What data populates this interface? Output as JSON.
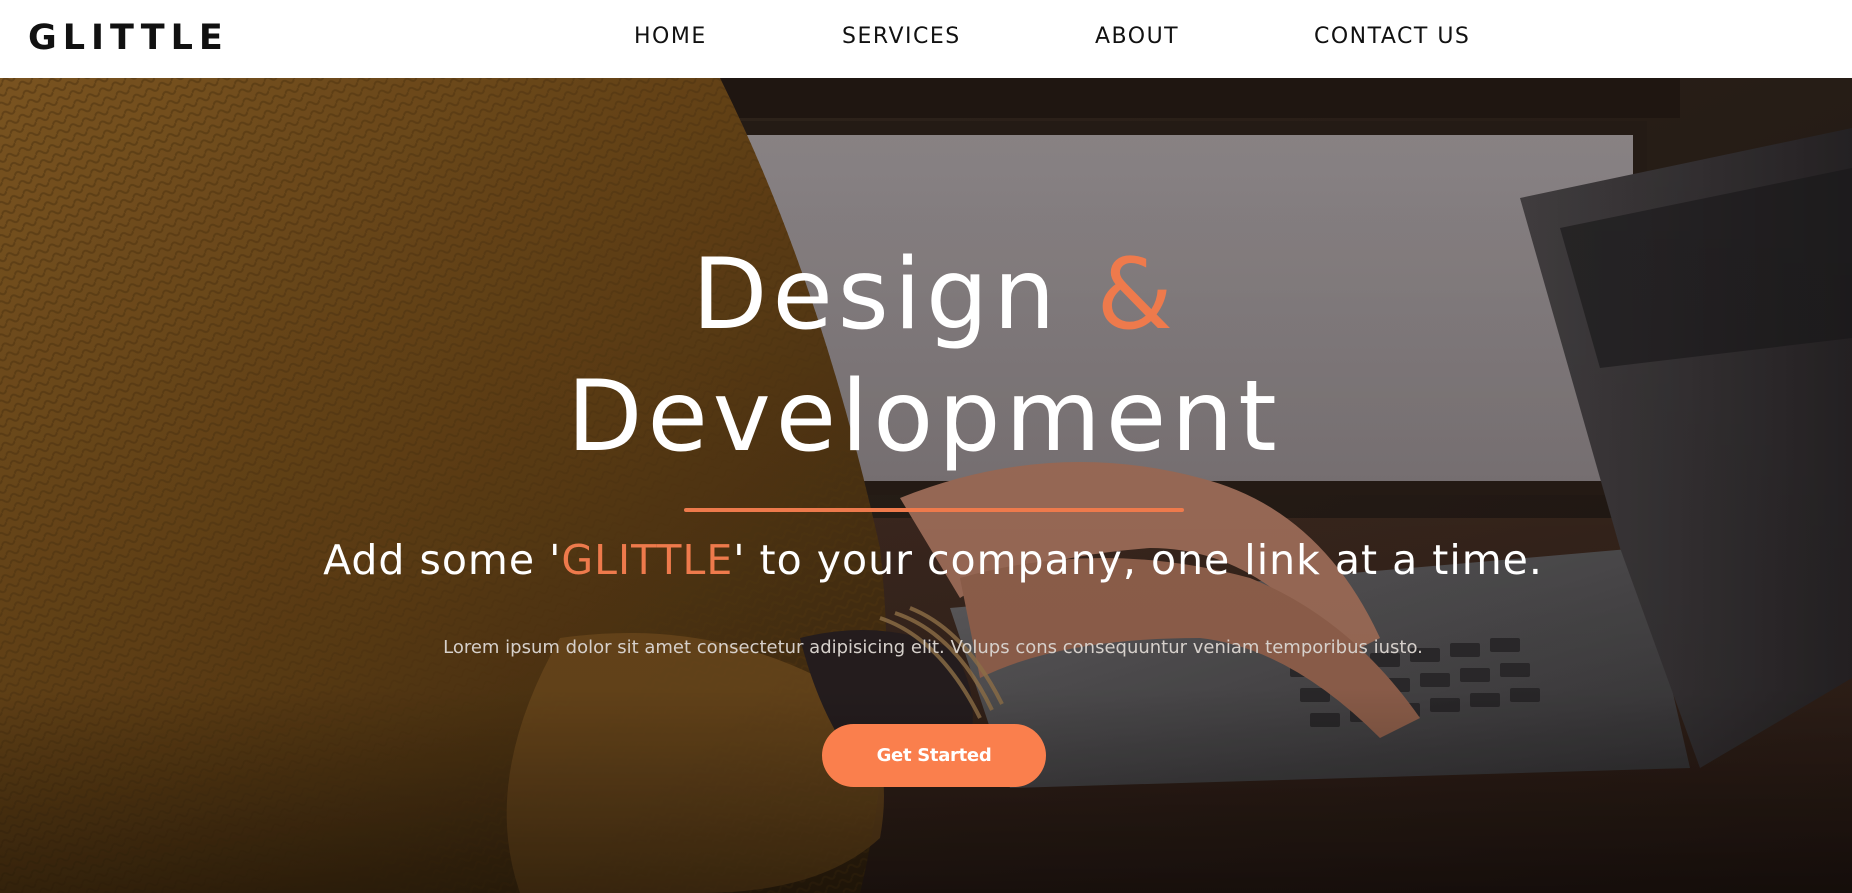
{
  "brand": {
    "logo": "GLITTLE"
  },
  "nav": {
    "items": [
      {
        "label": "HOME"
      },
      {
        "label": "SERVICES"
      },
      {
        "label": "ABOUT"
      },
      {
        "label": "CONTACT US"
      }
    ]
  },
  "hero": {
    "headline_word1": "Design",
    "headline_amp": "&",
    "headline_line2": "Development",
    "tagline_prefix": "Add some '",
    "tagline_brand": "GLITTLE",
    "tagline_suffix": "' to your company, one link at a time.",
    "lorem": "Lorem ipsum dolor sit amet consectetur adipisicing elit. Volups cons consequuntur veniam temporibus iusto.",
    "cta_label": "Get Started"
  },
  "colors": {
    "accent": "#ee7a4c",
    "cta_background": "#fa7f4d",
    "navbar_background": "#ffffff",
    "text_light": "#ffffff"
  }
}
